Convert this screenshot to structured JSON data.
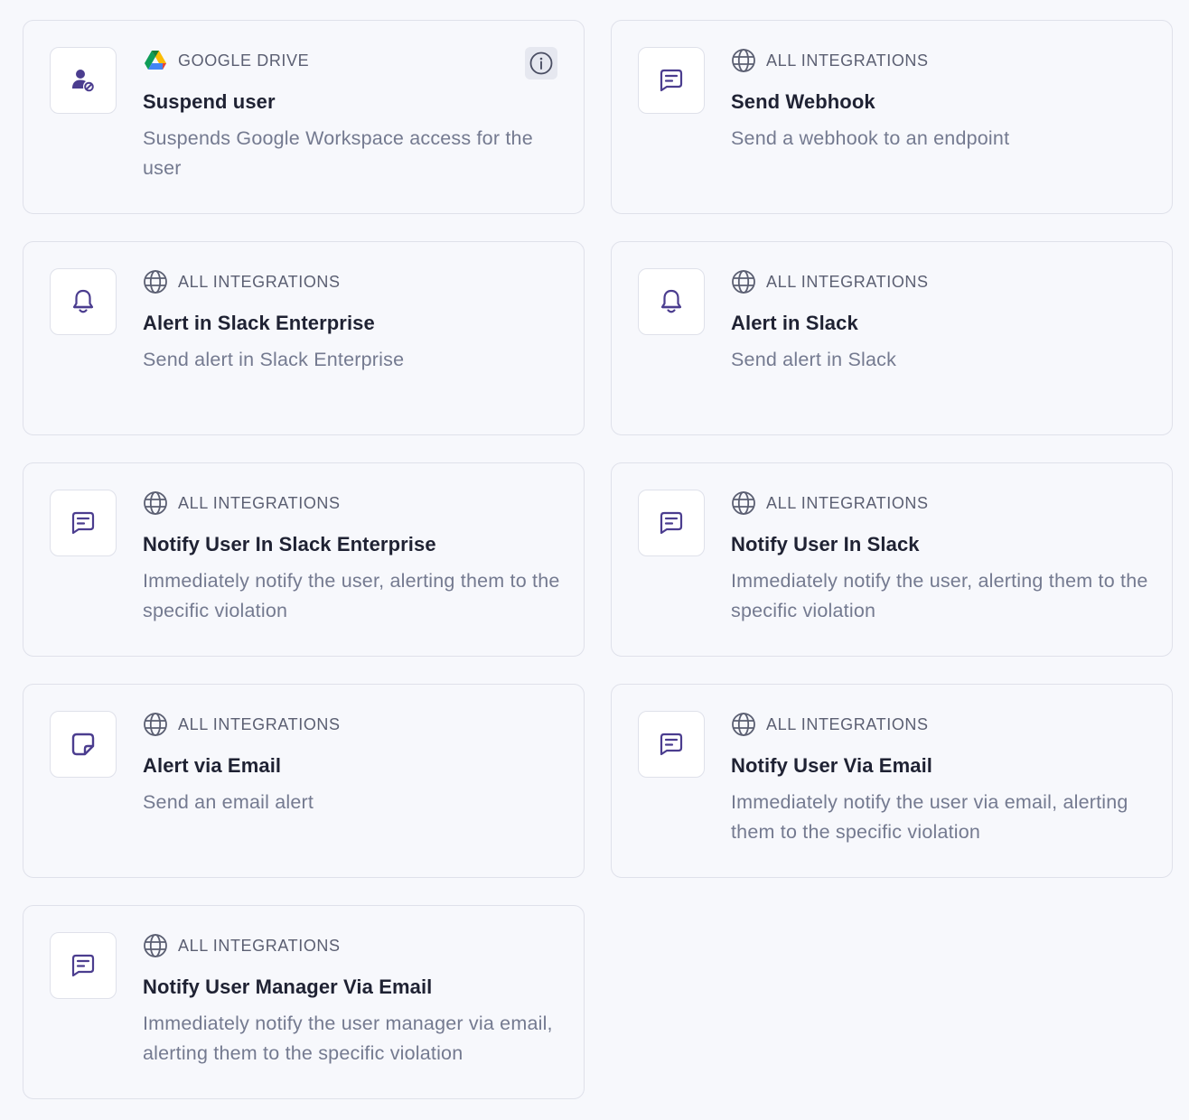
{
  "colors": {
    "accent": "#4b3d8f",
    "card_border": "#dfe1ea",
    "title": "#1f2233",
    "description": "#747a90",
    "source_label": "#5b5f72"
  },
  "actions": [
    {
      "source_icon": "google-drive-logo",
      "source": "GOOGLE DRIVE",
      "icon": "user-block-icon",
      "title": "Suspend user",
      "description": "Suspends Google Workspace access for the user",
      "has_info": true
    },
    {
      "source_icon": "globe-icon",
      "source": "ALL INTEGRATIONS",
      "icon": "message-icon",
      "title": "Send Webhook",
      "description": "Send a webhook to an endpoint"
    },
    {
      "source_icon": "globe-icon",
      "source": "ALL INTEGRATIONS",
      "icon": "bell-icon",
      "title": "Alert in Slack Enterprise",
      "description": "Send alert in Slack Enterprise"
    },
    {
      "source_icon": "globe-icon",
      "source": "ALL INTEGRATIONS",
      "icon": "bell-icon",
      "title": "Alert in Slack",
      "description": "Send alert in Slack"
    },
    {
      "source_icon": "globe-icon",
      "source": "ALL INTEGRATIONS",
      "icon": "message-icon",
      "title": "Notify User In Slack Enterprise",
      "description": "Immediately notify the user, alerting them to the specific violation"
    },
    {
      "source_icon": "globe-icon",
      "source": "ALL INTEGRATIONS",
      "icon": "message-icon",
      "title": "Notify User In Slack",
      "description": "Immediately notify the user, alerting them to the specific violation"
    },
    {
      "source_icon": "globe-icon",
      "source": "ALL INTEGRATIONS",
      "icon": "sticky-note-icon",
      "title": "Alert via Email",
      "description": "Send an email alert"
    },
    {
      "source_icon": "globe-icon",
      "source": "ALL INTEGRATIONS",
      "icon": "message-icon",
      "title": "Notify User Via Email",
      "description": "Immediately notify the user via email, alerting them to the specific violation"
    },
    {
      "source_icon": "globe-icon",
      "source": "ALL INTEGRATIONS",
      "icon": "message-icon",
      "title": "Notify User Manager Via Email",
      "description": "Immediately notify the user manager via email, alerting them to the specific violation"
    }
  ]
}
